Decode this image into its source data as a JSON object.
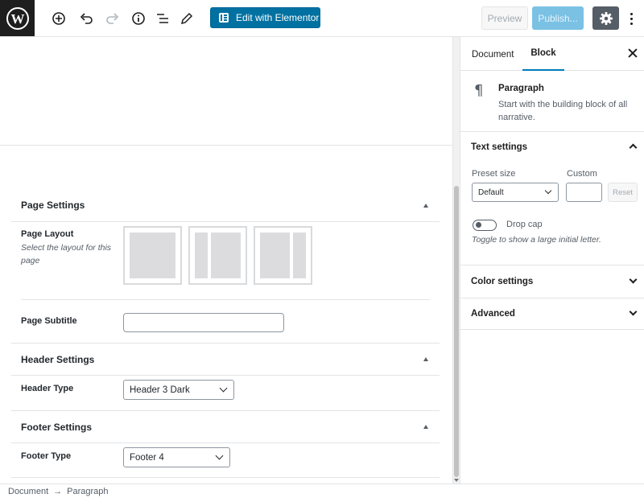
{
  "toolbar": {
    "elementor_label": "Edit with Elementor",
    "preview_label": "Preview",
    "publish_label": "Publish...",
    "icons": [
      "wordpress-icon",
      "add-block-icon",
      "undo-icon",
      "redo-icon",
      "info-icon",
      "block-navigation-icon",
      "tools-edit-icon",
      "gear-icon",
      "more-options-icon"
    ]
  },
  "meta": {
    "page_settings": {
      "title": "Page Settings",
      "layout_label": "Page Layout",
      "layout_desc": "Select the layout for this page",
      "subtitle_label": "Page Subtitle",
      "subtitle_value": ""
    },
    "header_settings": {
      "title": "Header Settings",
      "type_label": "Header Type",
      "type_value": "Header 3 Dark"
    },
    "footer_settings": {
      "title": "Footer Settings",
      "type_label": "Footer Type",
      "type_value": "Footer 4"
    }
  },
  "sidebar": {
    "tabs": [
      {
        "label": "Document",
        "active": false
      },
      {
        "label": "Block",
        "active": true
      }
    ],
    "block": {
      "name": "Paragraph",
      "description": "Start with the building block of all narrative."
    },
    "text_settings": {
      "title": "Text settings",
      "preset_label": "Preset size",
      "preset_value": "Default",
      "custom_label": "Custom",
      "custom_value": "",
      "reset_label": "Reset",
      "drop_cap_label": "Drop cap",
      "drop_cap_help": "Toggle to show a large initial letter."
    },
    "panels": [
      "Color settings",
      "Advanced"
    ]
  },
  "breadcrumb": {
    "items": [
      "Document",
      "Paragraph"
    ],
    "separator": "→"
  },
  "colors": {
    "primary": "#007cba",
    "elementor_button": "#0071a1",
    "publish_disabled": "#7ac1e4",
    "settings_active": "#555d66"
  }
}
